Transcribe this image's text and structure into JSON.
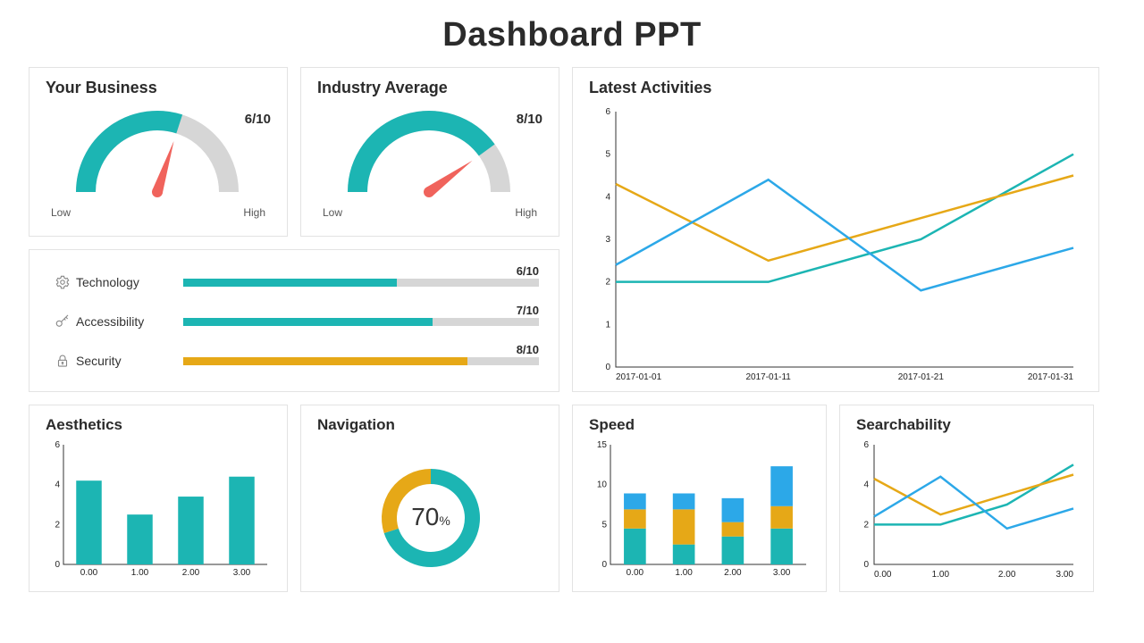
{
  "title": "Dashboard PPT",
  "colors": {
    "teal": "#1cb5b3",
    "orange": "#e6a817",
    "blue": "#2ca8e8",
    "red": "#f0635c",
    "gray": "#d6d6d6"
  },
  "gauges": [
    {
      "title": "Your Business",
      "value": 6,
      "max": 10,
      "score": "6/10",
      "low": "Low",
      "high": "High"
    },
    {
      "title": "Industry Average",
      "value": 8,
      "max": 10,
      "score": "8/10",
      "low": "Low",
      "high": "High"
    }
  ],
  "metrics": [
    {
      "icon": "gear-icon",
      "label": "Technology",
      "value": 6,
      "max": 10,
      "score": "6/10",
      "color": "#1cb5b3"
    },
    {
      "icon": "key-icon",
      "label": "Accessibility",
      "value": 7,
      "max": 10,
      "score": "7/10",
      "color": "#1cb5b3"
    },
    {
      "icon": "lock-icon",
      "label": "Security",
      "value": 8,
      "max": 10,
      "score": "8/10",
      "color": "#e6a817"
    }
  ],
  "activities": {
    "title": "Latest Activities"
  },
  "aesthetics": {
    "title": "Aesthetics"
  },
  "navigation": {
    "title": "Navigation",
    "percent_value": "70",
    "percent_sign": "%"
  },
  "speed": {
    "title": "Speed"
  },
  "searchability": {
    "title": "Searchability"
  },
  "chart_data": [
    {
      "name": "activities",
      "type": "line",
      "title": "Latest Activities",
      "x": [
        "2017-01-01",
        "2017-01-11",
        "2017-01-21",
        "2017-01-31"
      ],
      "series": [
        {
          "name": "teal",
          "color": "#1cb5b3",
          "values": [
            2.0,
            2.0,
            3.0,
            5.0
          ]
        },
        {
          "name": "orange",
          "color": "#e6a817",
          "values": [
            4.3,
            2.5,
            3.5,
            4.5
          ]
        },
        {
          "name": "blue",
          "color": "#2ca8e8",
          "values": [
            2.4,
            4.4,
            1.8,
            2.8
          ]
        }
      ],
      "ylim": [
        0,
        6
      ],
      "yticks": [
        0,
        1,
        2,
        3,
        4,
        5,
        6
      ]
    },
    {
      "name": "aesthetics",
      "type": "bar",
      "title": "Aesthetics",
      "categories": [
        "0.00",
        "1.00",
        "2.00",
        "3.00"
      ],
      "values": [
        4.2,
        2.5,
        3.4,
        4.4
      ],
      "color": "#1cb5b3",
      "ylim": [
        0,
        6
      ],
      "yticks": [
        0,
        2,
        4,
        6
      ]
    },
    {
      "name": "navigation",
      "type": "donut",
      "title": "Navigation",
      "segments": [
        {
          "name": "teal",
          "value": 70,
          "color": "#1cb5b3"
        },
        {
          "name": "orange",
          "value": 30,
          "color": "#e6a817"
        }
      ],
      "center_label": "70%"
    },
    {
      "name": "speed",
      "type": "stacked-bar",
      "title": "Speed",
      "categories": [
        "0.00",
        "1.00",
        "2.00",
        "3.00"
      ],
      "series": [
        {
          "name": "teal",
          "color": "#1cb5b3",
          "values": [
            4.5,
            2.5,
            3.5,
            4.5
          ]
        },
        {
          "name": "orange",
          "color": "#e6a817",
          "values": [
            2.4,
            4.4,
            1.8,
            2.8
          ]
        },
        {
          "name": "blue",
          "color": "#2ca8e8",
          "values": [
            2.0,
            2.0,
            3.0,
            5.0
          ]
        }
      ],
      "ylim": [
        0,
        15
      ],
      "yticks": [
        0,
        5,
        10,
        15
      ]
    },
    {
      "name": "searchability",
      "type": "line",
      "title": "Searchability",
      "x": [
        "0.00",
        "1.00",
        "2.00",
        "3.00"
      ],
      "series": [
        {
          "name": "teal",
          "color": "#1cb5b3",
          "values": [
            2.0,
            2.0,
            3.0,
            5.0
          ]
        },
        {
          "name": "orange",
          "color": "#e6a817",
          "values": [
            4.3,
            2.5,
            3.5,
            4.5
          ]
        },
        {
          "name": "blue",
          "color": "#2ca8e8",
          "values": [
            2.4,
            4.4,
            1.8,
            2.8
          ]
        }
      ],
      "ylim": [
        0,
        6
      ],
      "yticks": [
        0,
        2,
        4,
        6
      ]
    }
  ]
}
